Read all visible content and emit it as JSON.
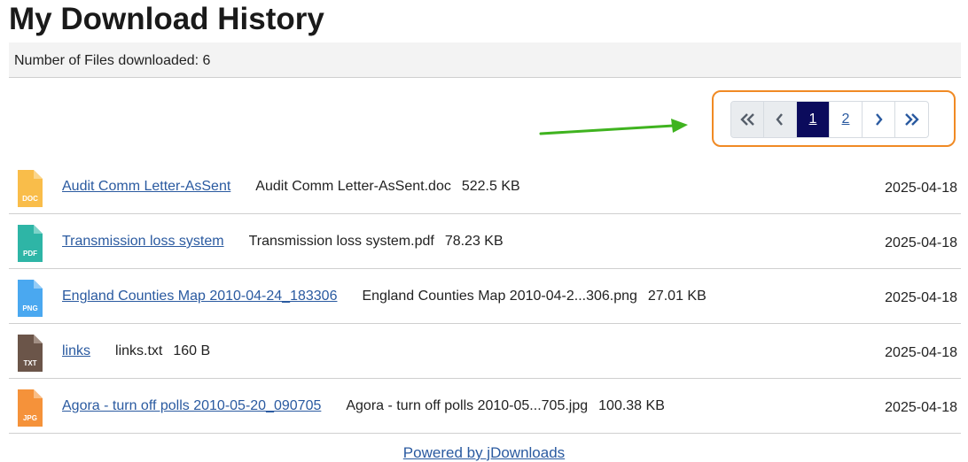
{
  "page": {
    "title": "My Download History"
  },
  "summary": {
    "text": "Number of Files downloaded: 6"
  },
  "pagination": {
    "first_icon": "double-chevron-left-icon",
    "prev_icon": "chevron-left-icon",
    "pages": [
      "1",
      "2"
    ],
    "current_page": "1",
    "next_icon": "chevron-right-icon",
    "last_icon": "double-chevron-right-icon",
    "highlight_color": "#f08a24",
    "active_color": "#0b0b5c"
  },
  "annotation": {
    "arrow_color": "#3fb31f"
  },
  "files": [
    {
      "title": "Audit Comm Letter-AsSent",
      "filename": "Audit Comm Letter-AsSent.doc",
      "size": "522.5 KB",
      "date": "2025-04-18",
      "type": "DOC",
      "color": "#f9bd4a"
    },
    {
      "title": "Transmission loss system",
      "filename": "Transmission loss system.pdf",
      "size": "78.23 KB",
      "date": "2025-04-18",
      "type": "PDF",
      "color": "#2eb5a6"
    },
    {
      "title": "England Counties Map 2010-04-24_183306",
      "filename": "England Counties Map 2010-04-2...306.png",
      "size": "27.01 KB",
      "date": "2025-04-18",
      "type": "PNG",
      "color": "#4aa8f0"
    },
    {
      "title": "links",
      "filename": "links.txt",
      "size": "160 B",
      "date": "2025-04-18",
      "type": "TXT",
      "color": "#6b5549"
    },
    {
      "title": "Agora - turn off polls 2010-05-20_090705",
      "filename": "Agora - turn off polls 2010-05...705.jpg",
      "size": "100.38 KB",
      "date": "2025-04-18",
      "type": "JPG",
      "color": "#f5923a"
    }
  ],
  "footer": {
    "powered_by": "Powered by jDownloads"
  }
}
